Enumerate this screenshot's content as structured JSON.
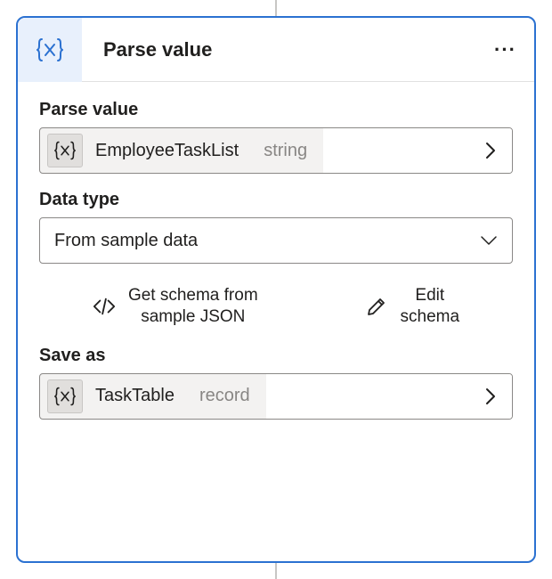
{
  "card": {
    "title": "Parse value",
    "icon_name": "variable-braces"
  },
  "fields": {
    "parseValue": {
      "label": "Parse value",
      "token": {
        "name": "EmployeeTaskList",
        "type": "string"
      }
    },
    "dataType": {
      "label": "Data type",
      "value": "From sample data"
    },
    "saveAs": {
      "label": "Save as",
      "token": {
        "name": "TaskTable",
        "type": "record"
      }
    }
  },
  "actions": {
    "getSchema": {
      "label": "Get schema from\nsample JSON"
    },
    "editSchema": {
      "label": "Edit\nschema"
    }
  }
}
